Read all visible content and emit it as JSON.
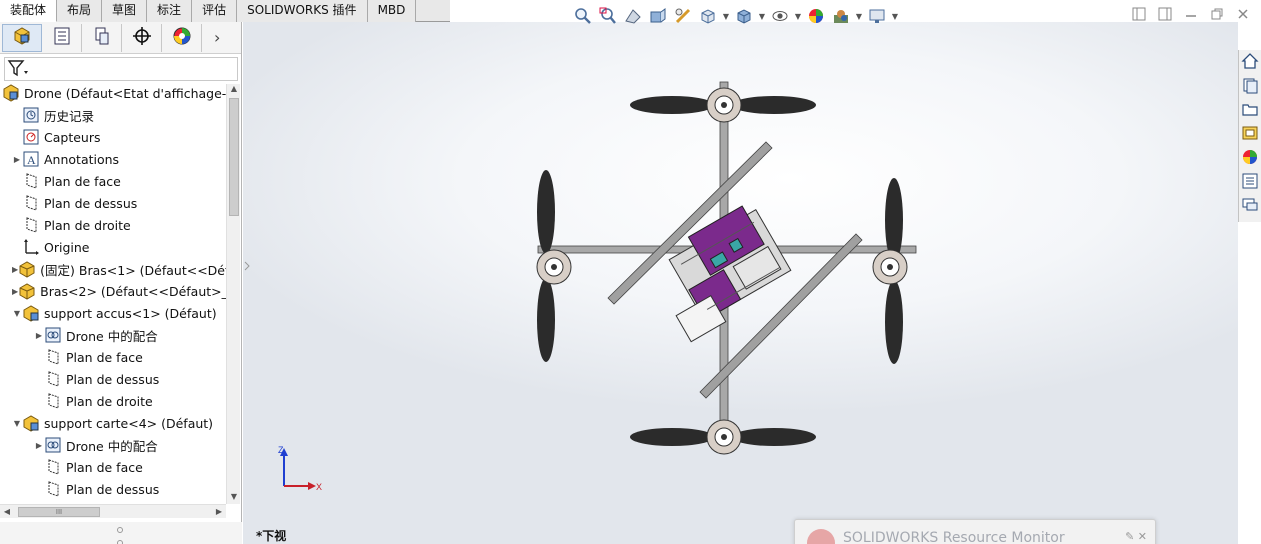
{
  "tabs": [
    "装配体",
    "布局",
    "草图",
    "标注",
    "评估",
    "SOLIDWORKS 插件",
    "MBD"
  ],
  "active_tab": "装配体",
  "tree": {
    "items": [
      {
        "label": "Drone  (Défaut<Etat d'affichage-1",
        "icon": "assembly-icon",
        "indent": 0,
        "expander": ""
      },
      {
        "label": "历史记录",
        "icon": "history-icon",
        "indent": 1,
        "expander": ""
      },
      {
        "label": "Capteurs",
        "icon": "sensors-icon",
        "indent": 1,
        "expander": ""
      },
      {
        "label": "Annotations",
        "icon": "annotations-icon",
        "indent": 1,
        "expander": "▶"
      },
      {
        "label": "Plan de face",
        "icon": "plane-icon",
        "indent": 1,
        "expander": ""
      },
      {
        "label": "Plan de dessus",
        "icon": "plane-icon",
        "indent": 1,
        "expander": ""
      },
      {
        "label": "Plan de droite",
        "icon": "plane-icon",
        "indent": 1,
        "expander": ""
      },
      {
        "label": "Origine",
        "icon": "origin-icon",
        "indent": 1,
        "expander": ""
      },
      {
        "label": "(固定) Bras<1> (Défaut<<Défa",
        "icon": "part-icon",
        "indent": 1,
        "expander": "▶"
      },
      {
        "label": "Bras<2> (Défaut<<Défaut>_E",
        "icon": "part-icon",
        "indent": 1,
        "expander": "▶"
      },
      {
        "label": "support accus<1> (Défaut)",
        "icon": "subassembly-icon",
        "indent": 1,
        "expander": "▼"
      },
      {
        "label": "Drone 中的配合",
        "icon": "mates-icon",
        "indent": 2,
        "expander": "▶"
      },
      {
        "label": "Plan de face",
        "icon": "plane-icon",
        "indent": 2,
        "expander": ""
      },
      {
        "label": "Plan de dessus",
        "icon": "plane-icon",
        "indent": 2,
        "expander": ""
      },
      {
        "label": "Plan de droite",
        "icon": "plane-icon",
        "indent": 2,
        "expander": ""
      },
      {
        "label": "support carte<4> (Défaut)",
        "icon": "subassembly-icon",
        "indent": 1,
        "expander": "▼"
      },
      {
        "label": "Drone 中的配合",
        "icon": "mates-icon",
        "indent": 2,
        "expander": "▶"
      },
      {
        "label": "Plan de face",
        "icon": "plane-icon",
        "indent": 2,
        "expander": ""
      },
      {
        "label": "Plan de dessus",
        "icon": "plane-icon",
        "indent": 2,
        "expander": ""
      }
    ]
  },
  "hscroll_thumb": "III",
  "view_label": "*下视",
  "triad": {
    "z": "Z",
    "x": "X"
  },
  "resource_monitor": {
    "title": "SOLIDWORKS Resource Monitor"
  },
  "colors": {
    "accent": "#7b2a8c",
    "propeller": "#2b2b2b",
    "arm": "#8d8d8d"
  }
}
